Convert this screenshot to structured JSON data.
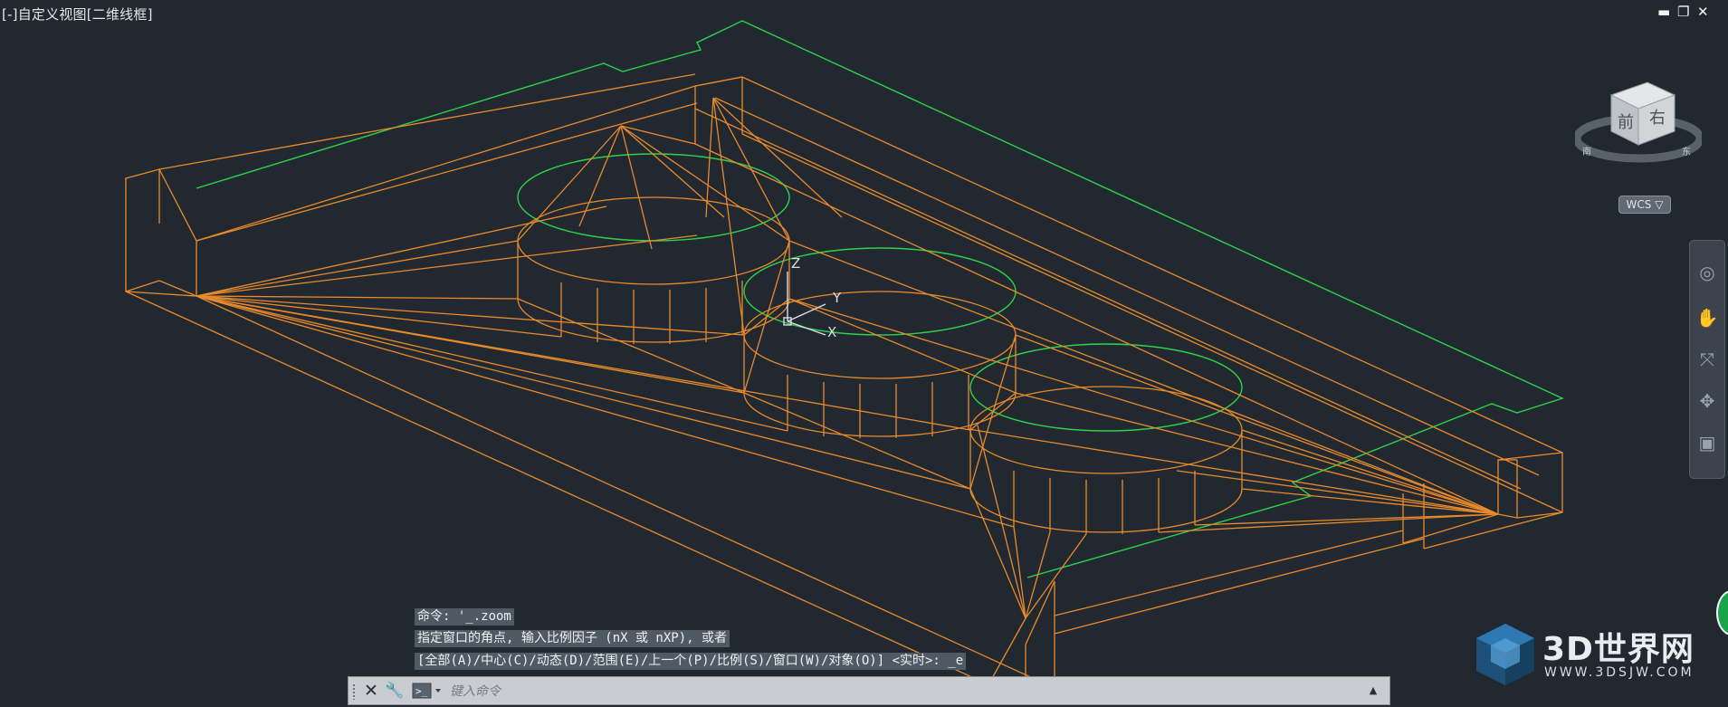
{
  "viewport": {
    "label": "[-]自定义视图[二维线框]",
    "controls": {
      "minimize": "▬",
      "restore": "❐",
      "close": "✕"
    }
  },
  "viewcube": {
    "faces": {
      "front": "前",
      "right": "右"
    },
    "compass": {
      "south": "南",
      "east": "东"
    },
    "wcs_label": "WCS ▽"
  },
  "ucs_icon": {
    "z": "Z",
    "y": "Y",
    "x": "X"
  },
  "navbar": {
    "items": [
      "steering-wheel-icon",
      "pan-hand-icon",
      "zoom-icon",
      "orbit-icon",
      "showmotion-icon"
    ]
  },
  "command": {
    "history": [
      "命令: '_.zoom",
      "指定窗口的角点, 输入比例因子 (nX 或 nXP), 或者",
      "[全部(A)/中心(C)/动态(D)/范围(E)/上一个(P)/比例(S)/窗口(W)/对象(O)] <实时>: _e"
    ],
    "input_placeholder": "键入命令",
    "input_value": ""
  },
  "watermark": {
    "brand": "3D世界网",
    "url": "WWW.3DSJW.COM"
  },
  "colors": {
    "background": "#212830",
    "geometry": "#e88a2c",
    "boundary": "#2dd14a",
    "command_line_bg": "#505a64"
  }
}
